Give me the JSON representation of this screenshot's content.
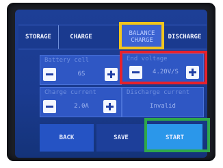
{
  "tabs": [
    {
      "label": "STORAGE"
    },
    {
      "label": "CHARGE"
    },
    {
      "label": "BALANCE\nCHARGE"
    },
    {
      "label": "DISCHARGE"
    }
  ],
  "battery_cell": {
    "title": "Battery cell",
    "value": "6S"
  },
  "end_voltage": {
    "title": "End voltage",
    "value": "4.20V/S"
  },
  "charge_current": {
    "title": "Charge current",
    "value": "2.0A"
  },
  "discharge_current": {
    "title": "Discharge current",
    "value": "Invalid"
  },
  "buttons": {
    "back": "BACK",
    "save": "SAVE",
    "start": "START"
  },
  "colors": {
    "highlight_yellow": "#f2c51d",
    "highlight_red": "#e8212b",
    "highlight_green": "#2fa84a"
  },
  "icons": {
    "decrease": "minus-icon",
    "increase": "plus-icon"
  }
}
